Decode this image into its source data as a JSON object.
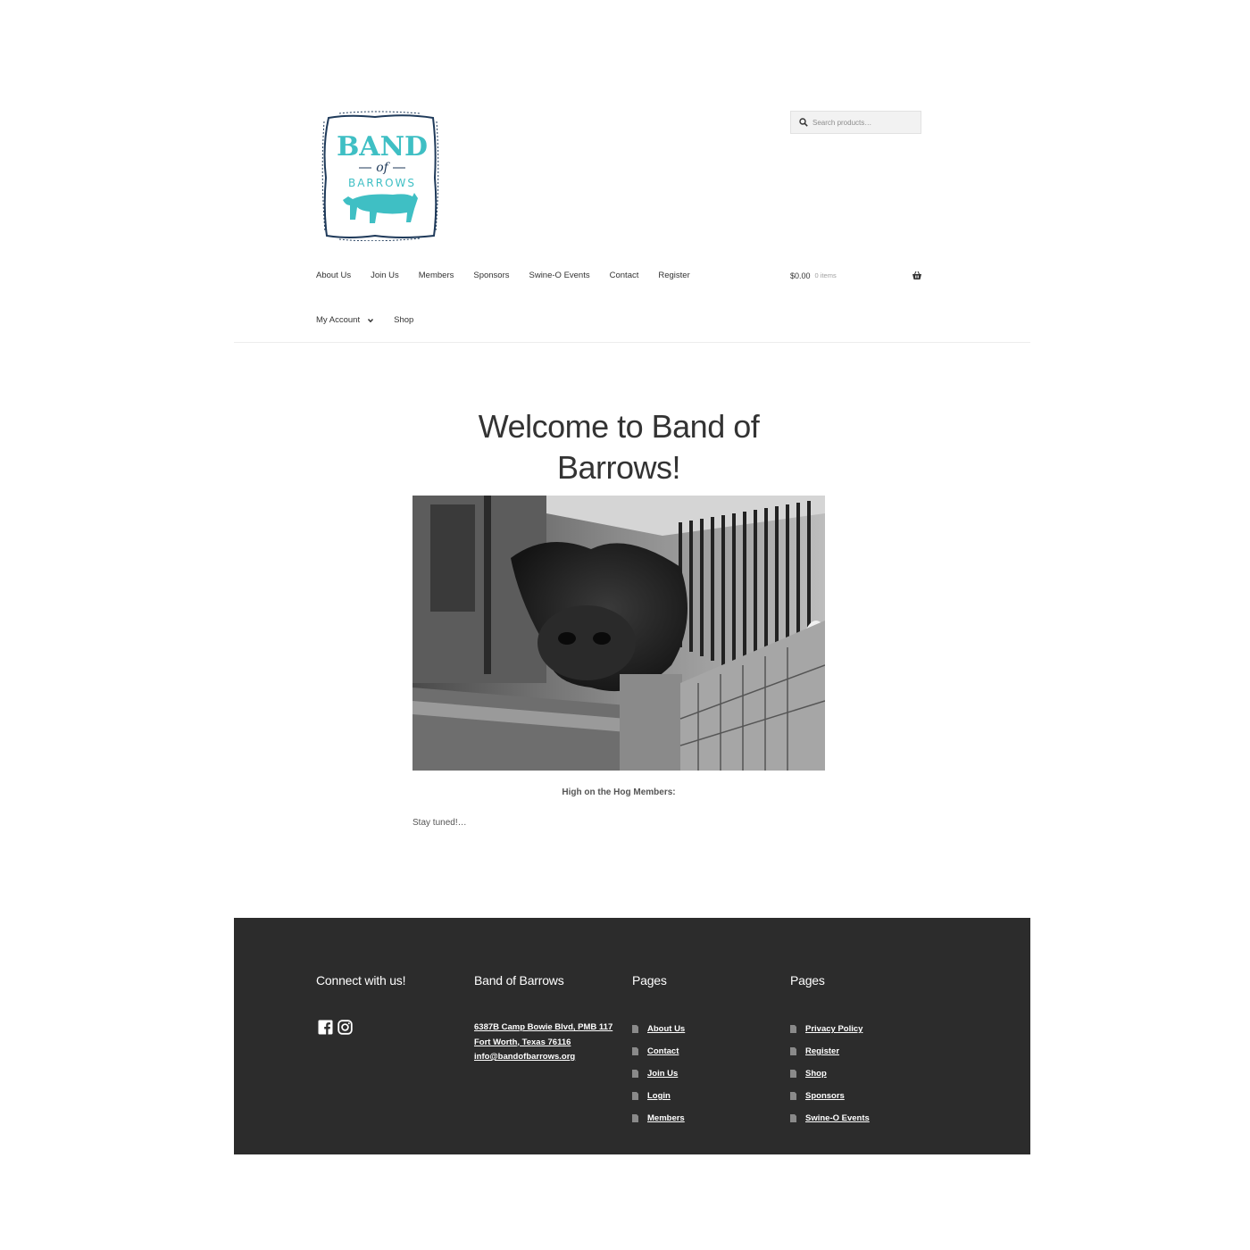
{
  "header": {
    "logo_text": {
      "line1": "BAND",
      "line2": "of",
      "line3": "BARROWS"
    },
    "search_placeholder": "Search products…"
  },
  "nav": {
    "primary": [
      "About Us",
      "Join Us",
      "Members",
      "Sponsors",
      "Swine-O Events",
      "Contact",
      "Register"
    ],
    "secondary": {
      "account": "My Account",
      "shop": "Shop"
    }
  },
  "cart": {
    "amount": "$0.00",
    "count": "0 items"
  },
  "main": {
    "title": "Welcome to Band of Barrows!",
    "caption": "High on the Hog Members:",
    "body_text": "Stay tuned!…"
  },
  "footer": {
    "col1": {
      "heading": "Connect with us!",
      "icons": [
        "facebook-icon",
        "instagram-icon"
      ]
    },
    "col2": {
      "heading": "Band of Barrows",
      "address_line1": "6387B Camp Bowie Blvd, PMB 117",
      "address_line2": "Fort Worth, Texas 76116",
      "email": "info@bandofbarrows.org"
    },
    "col3": {
      "heading": "Pages",
      "links": [
        "About Us",
        "Contact",
        "Join Us",
        "Login",
        "Members"
      ]
    },
    "col4": {
      "heading": "Pages",
      "links": [
        "Privacy Policy",
        "Register",
        "Shop",
        "Sponsors",
        "Swine-O Events"
      ]
    }
  },
  "colors": {
    "brand_teal": "#3fbfc4",
    "logo_navy": "#1f3a5a",
    "footer_bg": "#2c2c2c"
  }
}
